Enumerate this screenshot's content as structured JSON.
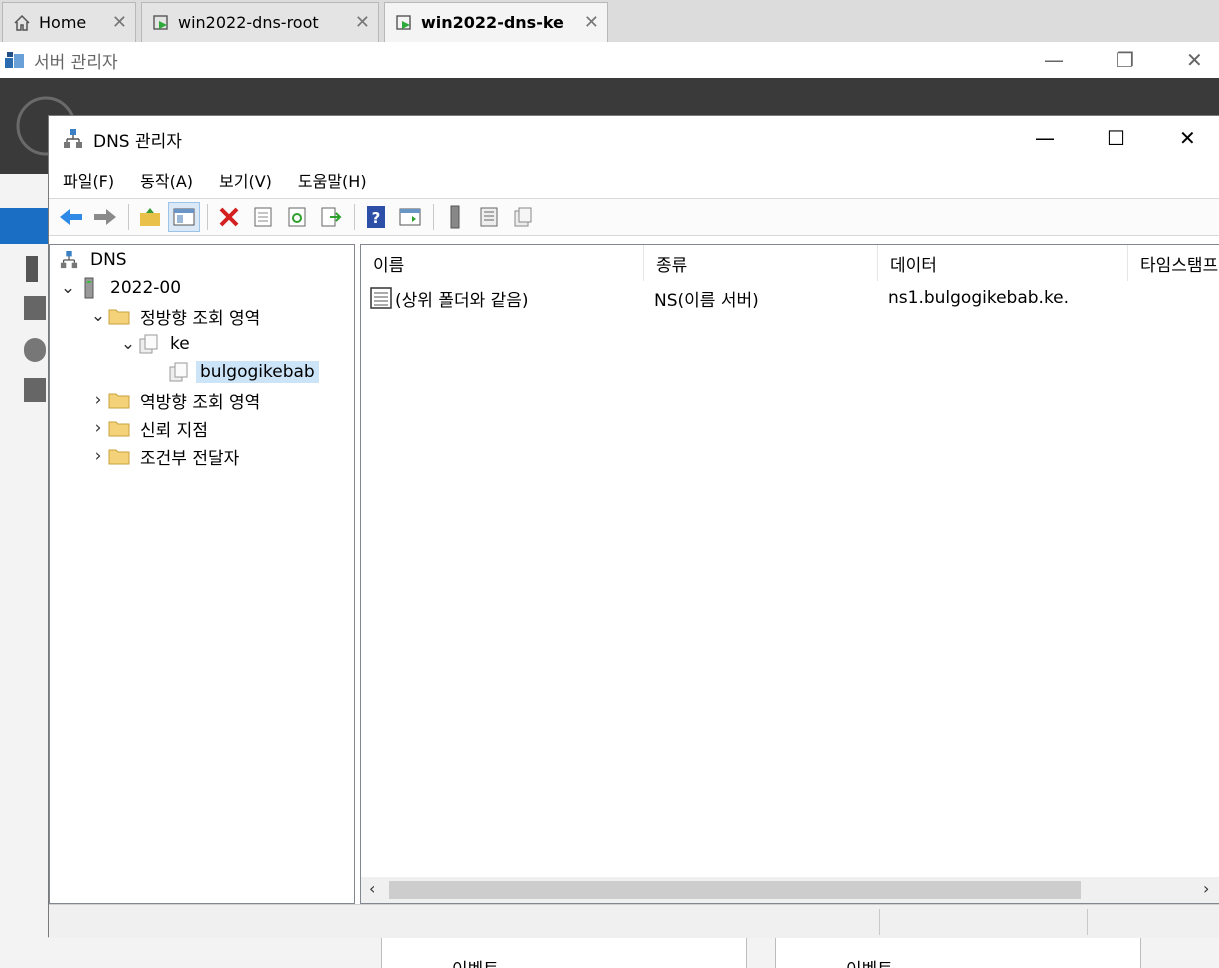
{
  "host_tabs": [
    {
      "label": "Home",
      "icon": "home-icon",
      "active": false
    },
    {
      "label": "win2022-dns-root",
      "icon": "vm-icon",
      "active": false
    },
    {
      "label": "win2022-dns-ke",
      "icon": "vm-icon",
      "active": true
    }
  ],
  "server_manager": {
    "title": "서버 관리자",
    "bottom_cards": [
      "이벤트",
      "이벤트"
    ]
  },
  "dns_window": {
    "title": "DNS 관리자",
    "menu": [
      "파일(F)",
      "동작(A)",
      "보기(V)",
      "도움말(H)"
    ],
    "toolbar_icons": [
      "back-icon",
      "forward-icon",
      "up-folder-icon",
      "show-hide-console-tree-icon",
      "delete-icon",
      "properties-icon",
      "refresh-icon",
      "export-list-icon",
      "help-icon",
      "action-pane-icon",
      "server-icon",
      "list-icon",
      "zone-icon"
    ]
  },
  "tree": {
    "root": "DNS",
    "server": "2022-00",
    "forward_zones": "정방향 조회 영역",
    "zone_ke": "ke",
    "zone_selected": "bulgogikebab",
    "reverse_zones": "역방향 조회 영역",
    "trust_points": "신뢰 지점",
    "conditional_forwarders": "조건부 전달자"
  },
  "list": {
    "columns": [
      "이름",
      "종류",
      "데이터",
      "타임스탬프"
    ],
    "rows": [
      {
        "name": "(상위 폴더와 같음)",
        "type": "NS(이름 서버)",
        "data": "ns1.bulgogikebab.ke."
      }
    ]
  },
  "colors": {
    "accent": "#0078d7",
    "selection": "#cce4f7",
    "sm_header": "#3a3a3a"
  }
}
